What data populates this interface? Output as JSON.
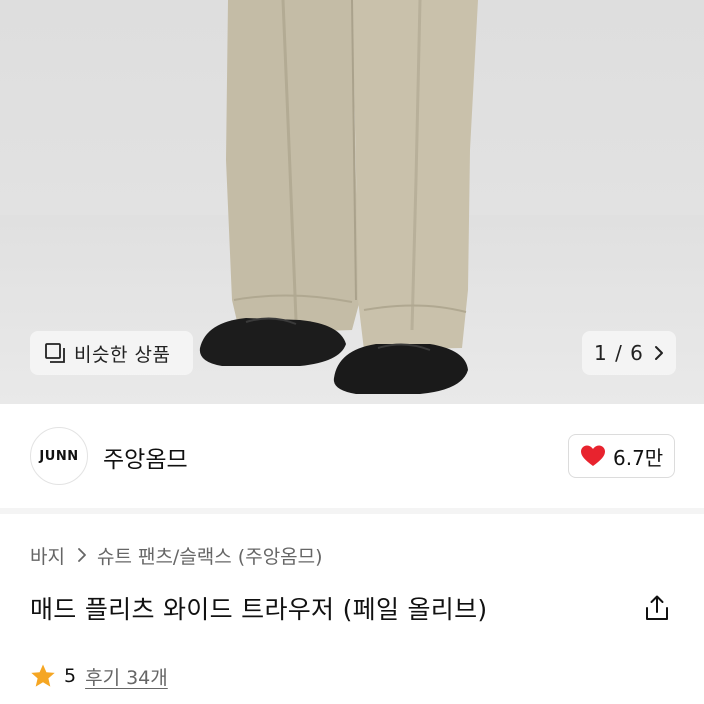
{
  "hero": {
    "similar_label": "비슷한 상품",
    "pager": "1 / 6",
    "icons": {
      "similar": "similar-products-icon",
      "next": "chevron-right-icon"
    }
  },
  "brand": {
    "logo_text": "JUNN",
    "name": "주앙옴므",
    "likes": "6.7만",
    "heart_color": "#e8232e"
  },
  "breadcrumb": {
    "category": "바지",
    "subcategory": "슈트 팬츠/슬랙스 (주앙옴므)"
  },
  "product": {
    "title": "매드 플리츠 와이드 트라우저 (페일 올리브)"
  },
  "rating": {
    "score": "5",
    "reviews": "후기 34개",
    "star_color": "#f5a623"
  }
}
